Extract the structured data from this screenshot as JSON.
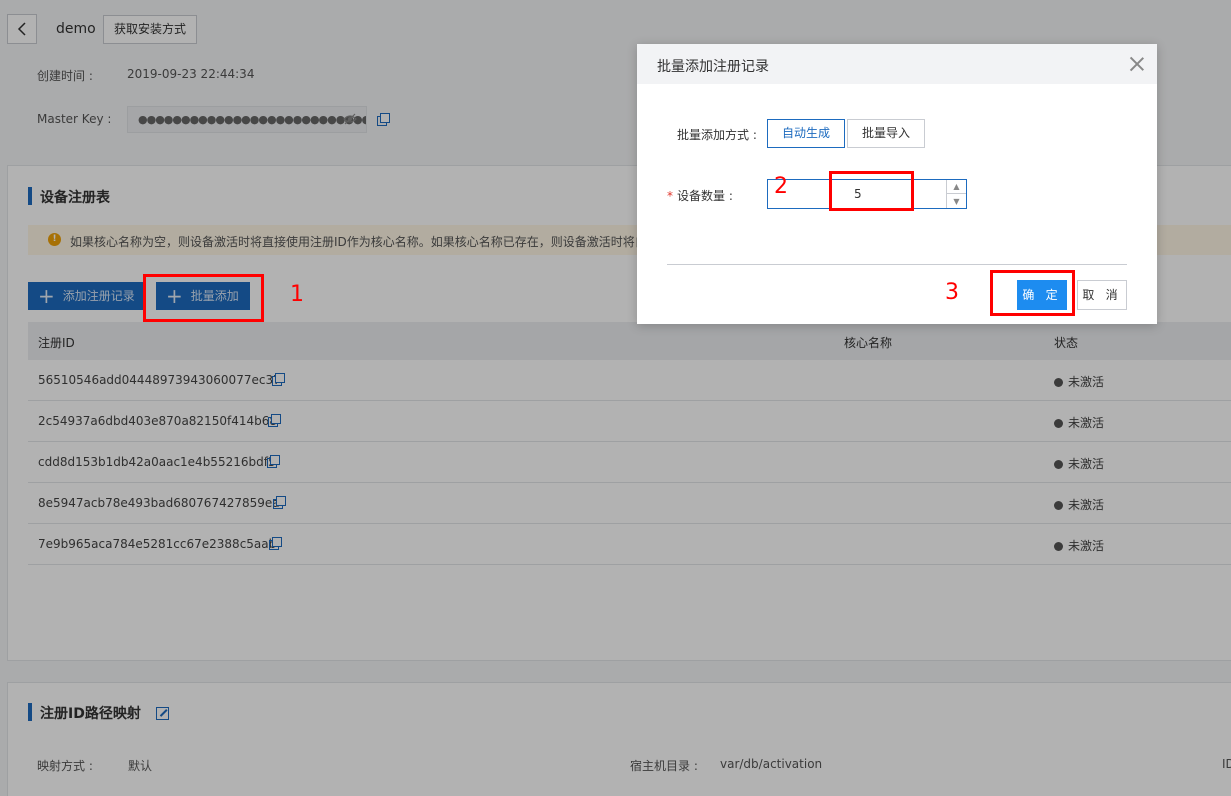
{
  "header": {
    "device_name": "demo",
    "install_button": "获取安装方式"
  },
  "meta": {
    "created_label": "创建时间 :",
    "created_value": "2019-09-23 22:44:34",
    "masterkey_label": "Master Key :",
    "masterkey_value": "●●●●●●●●●●●●●●●●●●●●●●●●●●●●●●●●●●●●●●●●"
  },
  "registry": {
    "title": "设备注册表",
    "notice": "如果核心名称为空，则设备激活时将直接使用注册ID作为核心名称。如果核心名称已存在，则设备激活时将自",
    "add_record_button": "添加注册记录",
    "batch_add_button": "批量添加",
    "columns": [
      "注册ID",
      "核心名称",
      "状态"
    ],
    "rows": [
      {
        "id": "56510546add04448973943060077ec37",
        "core_name": "",
        "status": "未激活"
      },
      {
        "id": "2c54937a6dbd403e870a82150f414b68",
        "core_name": "",
        "status": "未激活"
      },
      {
        "id": "cdd8d153b1db42a0aac1e4b55216bdf5",
        "core_name": "",
        "status": "未激活"
      },
      {
        "id": "8e5947acb78e493bad680767427859ea",
        "core_name": "",
        "status": "未激活"
      },
      {
        "id": "7e9b965aca784e5281cc67e2388c5aab",
        "core_name": "",
        "status": "未激活"
      }
    ]
  },
  "path_mapping": {
    "title": "注册ID路径映射",
    "mode_label": "映射方式 :",
    "mode_value": "默认",
    "host_dir_label": "宿主机目录 :",
    "host_dir_value": "var/db/activation",
    "trailing_text": "ID"
  },
  "modal": {
    "title": "批量添加注册记录",
    "method_label": "批量添加方式 :",
    "method_options": [
      "自动生成",
      "批量导入"
    ],
    "method_selected": "自动生成",
    "count_label": "设备数量 :",
    "count_value": "5",
    "ok_button": "确 定",
    "cancel_button": "取 消"
  },
  "annotations": [
    "1",
    "2",
    "3"
  ],
  "colors": {
    "primary": "#1d6bbf",
    "confirm": "#1d8cf0",
    "annotation": "#ff0000",
    "required": "#e0352b"
  }
}
